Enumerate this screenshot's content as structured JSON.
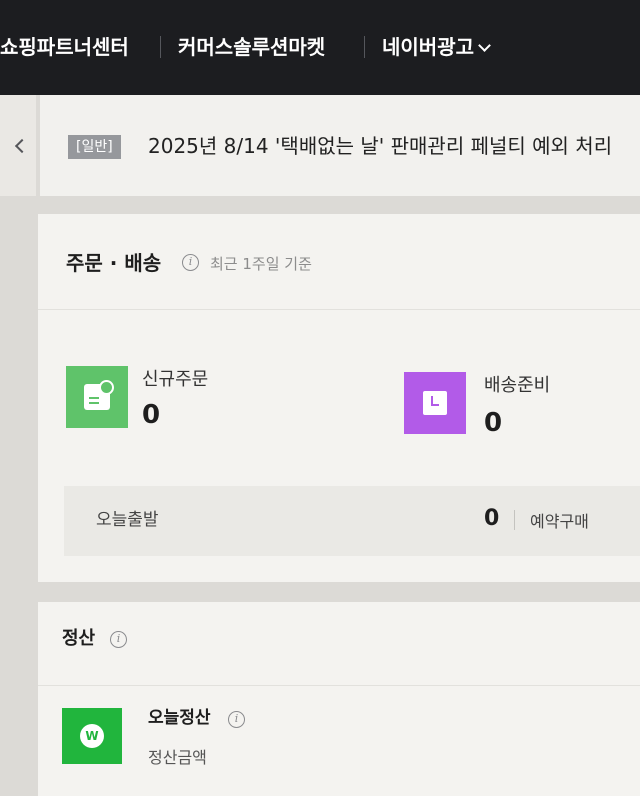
{
  "topnav": {
    "items": [
      "쇼핑파트너센터",
      "커머스솔루션마켓",
      "네이버광고"
    ]
  },
  "notice": {
    "badge": "[일반]",
    "text": "2025년 8/14 '택배없는 날' 판매관리 페널티 예외 처리"
  },
  "order": {
    "title": "주문 · 배송",
    "subtitle": "최근 1주일 기준",
    "new_orders": {
      "label": "신규주문",
      "value": "0",
      "icon": "document-icon",
      "color": "#5fc36a"
    },
    "prepare": {
      "label": "배송준비",
      "value": "0",
      "icon": "clock-icon",
      "color": "#b25be8"
    },
    "today_departure": {
      "label": "오늘출발",
      "value": "0"
    },
    "reservation": {
      "label": "예약구매"
    }
  },
  "settlement": {
    "title": "정산",
    "today": {
      "title": "오늘정산",
      "amount_label": "정산금액",
      "icon_text": "W",
      "color": "#21b53d"
    }
  }
}
